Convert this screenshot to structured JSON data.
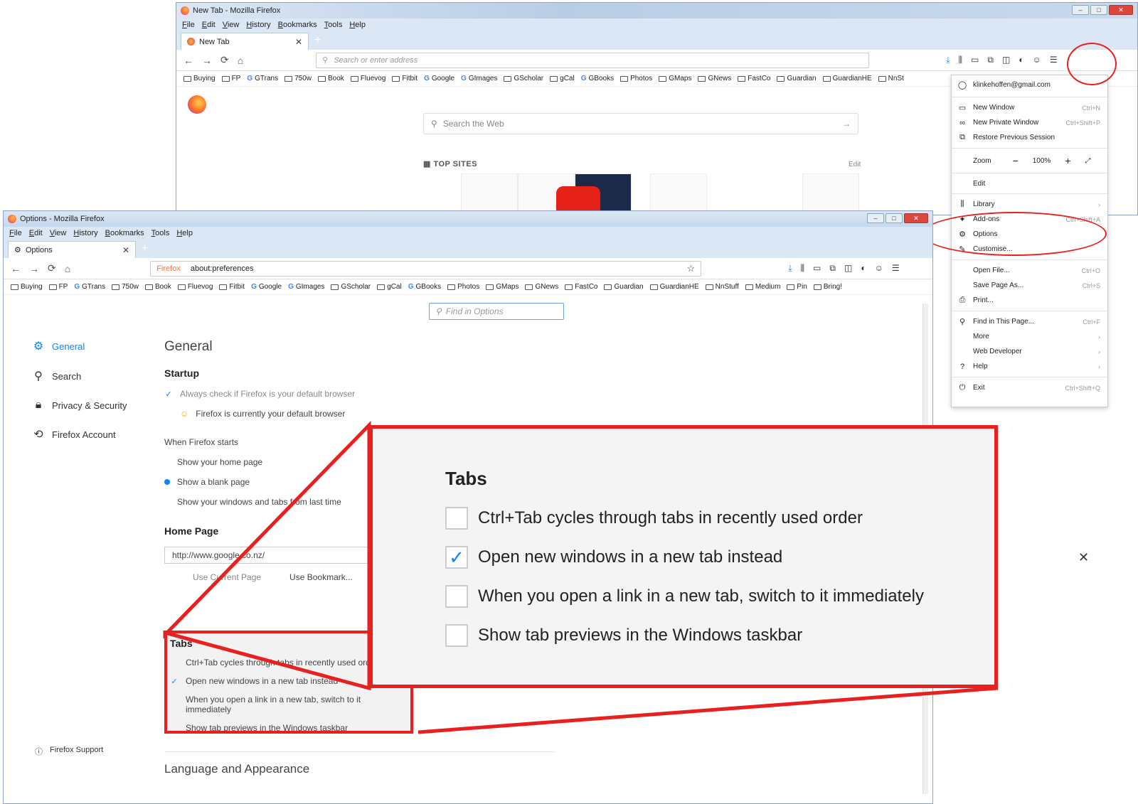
{
  "back_window": {
    "title": "New Tab - Mozilla Firefox",
    "menu": [
      "File",
      "Edit",
      "View",
      "History",
      "Bookmarks",
      "Tools",
      "Help"
    ],
    "tab_label": "New Tab",
    "url_placeholder": "Search or enter address",
    "bookmarks": [
      "Buying",
      "FP",
      "GTrans",
      "750w",
      "Book",
      "Fluevog",
      "Fitbit",
      "Google",
      "GImages",
      "GScholar",
      "gCal",
      "GBooks",
      "Photos",
      "GMaps",
      "GNews",
      "FastCo",
      "Guardian",
      "GuardianHE",
      "NnSt"
    ],
    "web_search_placeholder": "Search the Web",
    "top_sites_label": "TOP SITES",
    "top_sites_edit": "Edit"
  },
  "menu_panel": {
    "account": "klinkehoffen@gmail.com",
    "items1": [
      {
        "label": "New Window",
        "shortcut": "Ctrl+N",
        "icon": "window-icon"
      },
      {
        "label": "New Private Window",
        "shortcut": "Ctrl+Shift+P",
        "icon": "mask-icon"
      },
      {
        "label": "Restore Previous Session",
        "shortcut": "",
        "icon": "restore-icon"
      }
    ],
    "zoom_label": "Zoom",
    "zoom_value": "100%",
    "edit_label": "Edit",
    "items2": [
      {
        "label": "Library",
        "shortcut": "›"
      },
      {
        "label": "Add-ons",
        "shortcut": "Ctrl+Shift+A"
      },
      {
        "label": "Options",
        "shortcut": ""
      },
      {
        "label": "Customise...",
        "shortcut": ""
      }
    ],
    "items3": [
      {
        "label": "Open File...",
        "shortcut": "Ctrl+O"
      },
      {
        "label": "Save Page As...",
        "shortcut": "Ctrl+S"
      },
      {
        "label": "Print...",
        "shortcut": ""
      }
    ],
    "items4": [
      {
        "label": "Find in This Page...",
        "shortcut": "Ctrl+F"
      },
      {
        "label": "More",
        "shortcut": "›"
      },
      {
        "label": "Web Developer",
        "shortcut": "›"
      },
      {
        "label": "Help",
        "shortcut": "›"
      }
    ],
    "exit_label": "Exit",
    "exit_shortcut": "Ctrl+Shift+Q"
  },
  "main_window": {
    "title": "Options - Mozilla Firefox",
    "menu": [
      "File",
      "Edit",
      "View",
      "History",
      "Bookmarks",
      "Tools",
      "Help"
    ],
    "tab_label": "Options",
    "url_identity": "Firefox",
    "url": "about:preferences",
    "bookmarks": [
      "Buying",
      "FP",
      "GTrans",
      "750w",
      "Book",
      "Fluevog",
      "Fitbit",
      "Google",
      "GImages",
      "GScholar",
      "gCal",
      "GBooks",
      "Photos",
      "GMaps",
      "GNews",
      "FastCo",
      "Guardian",
      "GuardianHE",
      "NnStuff",
      "Medium",
      "Pin",
      "Bring!"
    ],
    "find_placeholder": "Find in Options",
    "sidebar": [
      {
        "label": "General",
        "icon": "gear-icon"
      },
      {
        "label": "Search",
        "icon": "search-icon"
      },
      {
        "label": "Privacy & Security",
        "icon": "lock-icon"
      },
      {
        "label": "Firefox Account",
        "icon": "sync-icon"
      }
    ],
    "support_label": "Firefox Support",
    "general_heading": "General",
    "startup_heading": "Startup",
    "always_check": "Always check if Firefox is your default browser",
    "default_status": "Firefox is currently your default browser",
    "when_starts": "When Firefox starts",
    "start_options": [
      "Show your home page",
      "Show a blank page",
      "Show your windows and tabs from last time"
    ],
    "home_heading": "Home Page",
    "home_url": "http://www.google.co.nz/",
    "use_current": "Use Current Page",
    "use_bookmark": "Use Bookmark...",
    "tabs_heading": "Tabs",
    "tab_options": [
      {
        "label": "Ctrl+Tab cycles through tabs in recently used order",
        "checked": false
      },
      {
        "label": "Open new windows in a new tab instead",
        "checked": true
      },
      {
        "label": "When you open a link in a new tab, switch to it immediately",
        "checked": false
      },
      {
        "label": "Show tab previews in the Windows taskbar",
        "checked": false
      }
    ],
    "lang_heading": "Language and Appearance"
  },
  "callout": {
    "title": "Tabs",
    "options": [
      {
        "label": "Ctrl+Tab cycles through tabs in recently used order",
        "checked": false
      },
      {
        "label": "Open new windows in a new tab instead",
        "checked": true
      },
      {
        "label": "When you open a link in a new tab, switch to it immediately",
        "checked": false
      },
      {
        "label": "Show tab previews in the Windows taskbar",
        "checked": false
      }
    ]
  },
  "colors": {
    "highlight": "#e8201f",
    "accent": "#0a84ff"
  }
}
